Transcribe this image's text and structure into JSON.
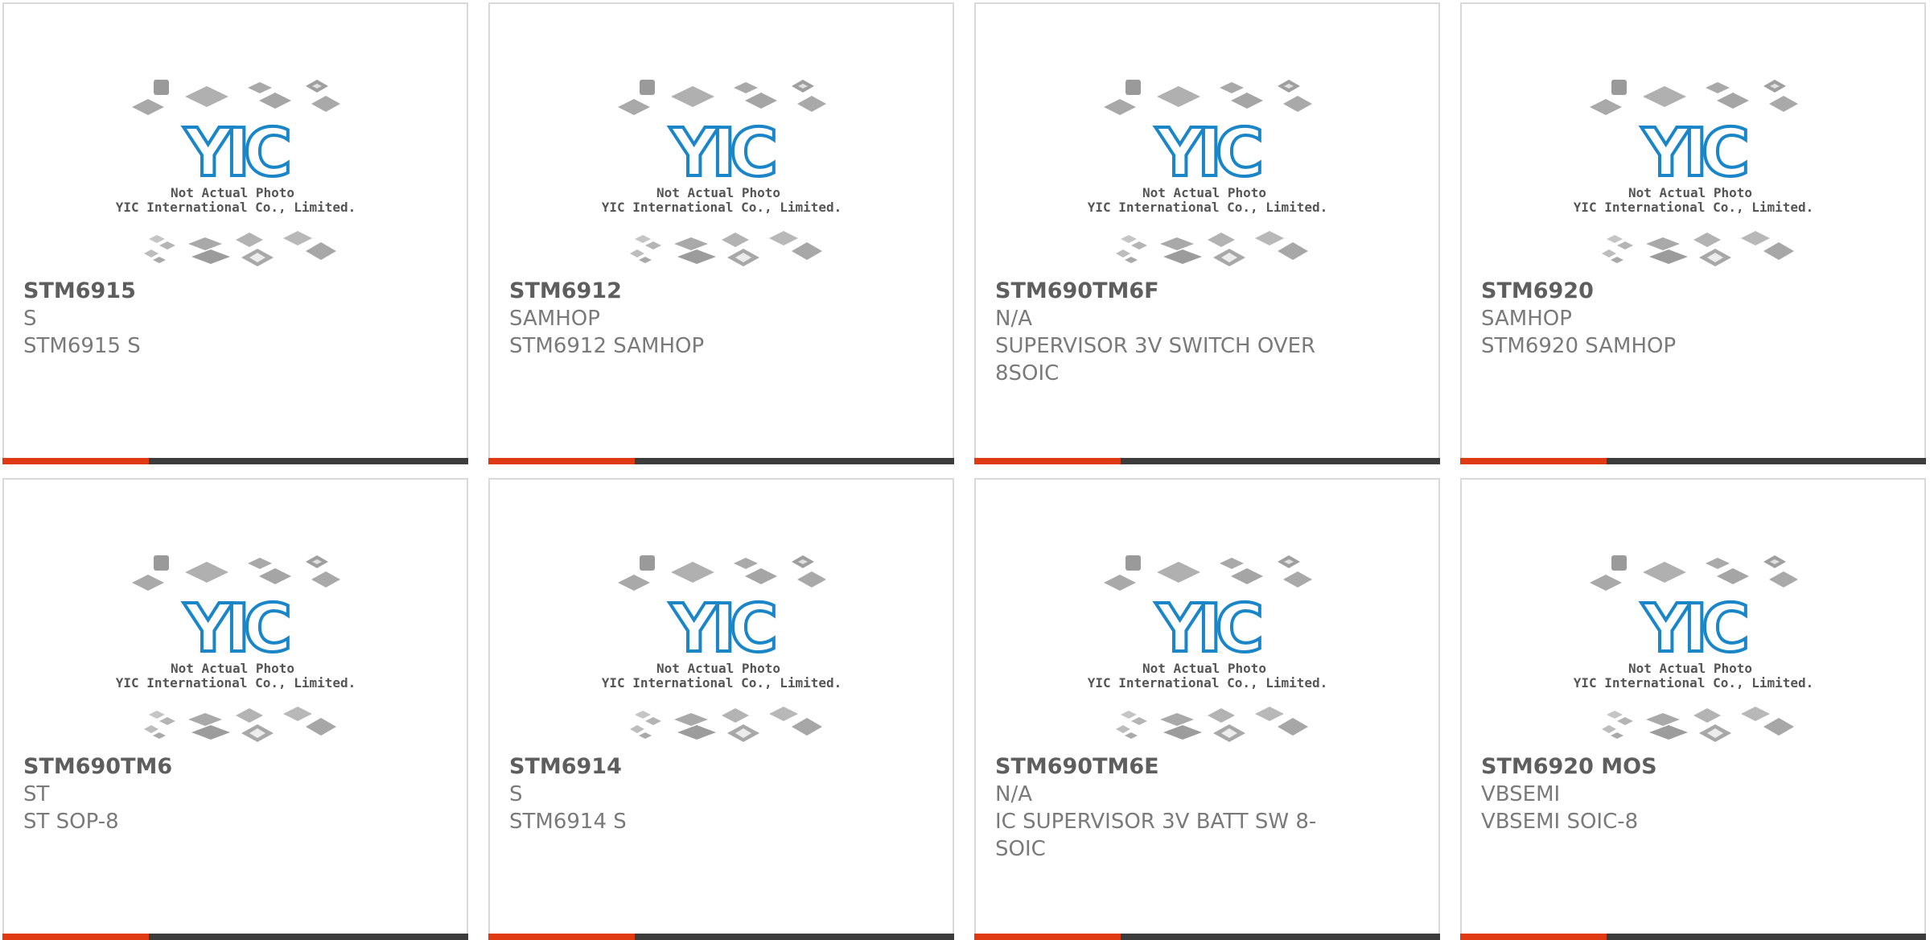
{
  "photo": {
    "logo_text": "YIC",
    "caption_line1": "Not Actual Photo",
    "caption_line2": "YIC International Co., Limited.",
    "logo_color": "#1a86c8",
    "chip_color": "#a9a9a9"
  },
  "colors": {
    "accent": "#e03a12",
    "bar": "#3c3c3c",
    "border": "#d9d9d9"
  },
  "products": [
    {
      "part": "STM6915",
      "manufacturer": "S",
      "description": "STM6915 S"
    },
    {
      "part": "STM6912",
      "manufacturer": "SAMHOP",
      "description": "STM6912 SAMHOP"
    },
    {
      "part": "STM690TM6F",
      "manufacturer": "N/A",
      "description": "SUPERVISOR 3V SWITCH OVER 8SOIC"
    },
    {
      "part": "STM6920",
      "manufacturer": "SAMHOP",
      "description": "STM6920 SAMHOP"
    },
    {
      "part": "STM690TM6",
      "manufacturer": "ST",
      "description": "ST SOP-8"
    },
    {
      "part": "STM6914",
      "manufacturer": "S",
      "description": "STM6914 S"
    },
    {
      "part": "STM690TM6E",
      "manufacturer": "N/A",
      "description": "IC SUPERVISOR 3V BATT SW 8-SOIC"
    },
    {
      "part": "STM6920 MOS",
      "manufacturer": "VBSEMI",
      "description": "VBSEMI SOIC-8"
    }
  ]
}
